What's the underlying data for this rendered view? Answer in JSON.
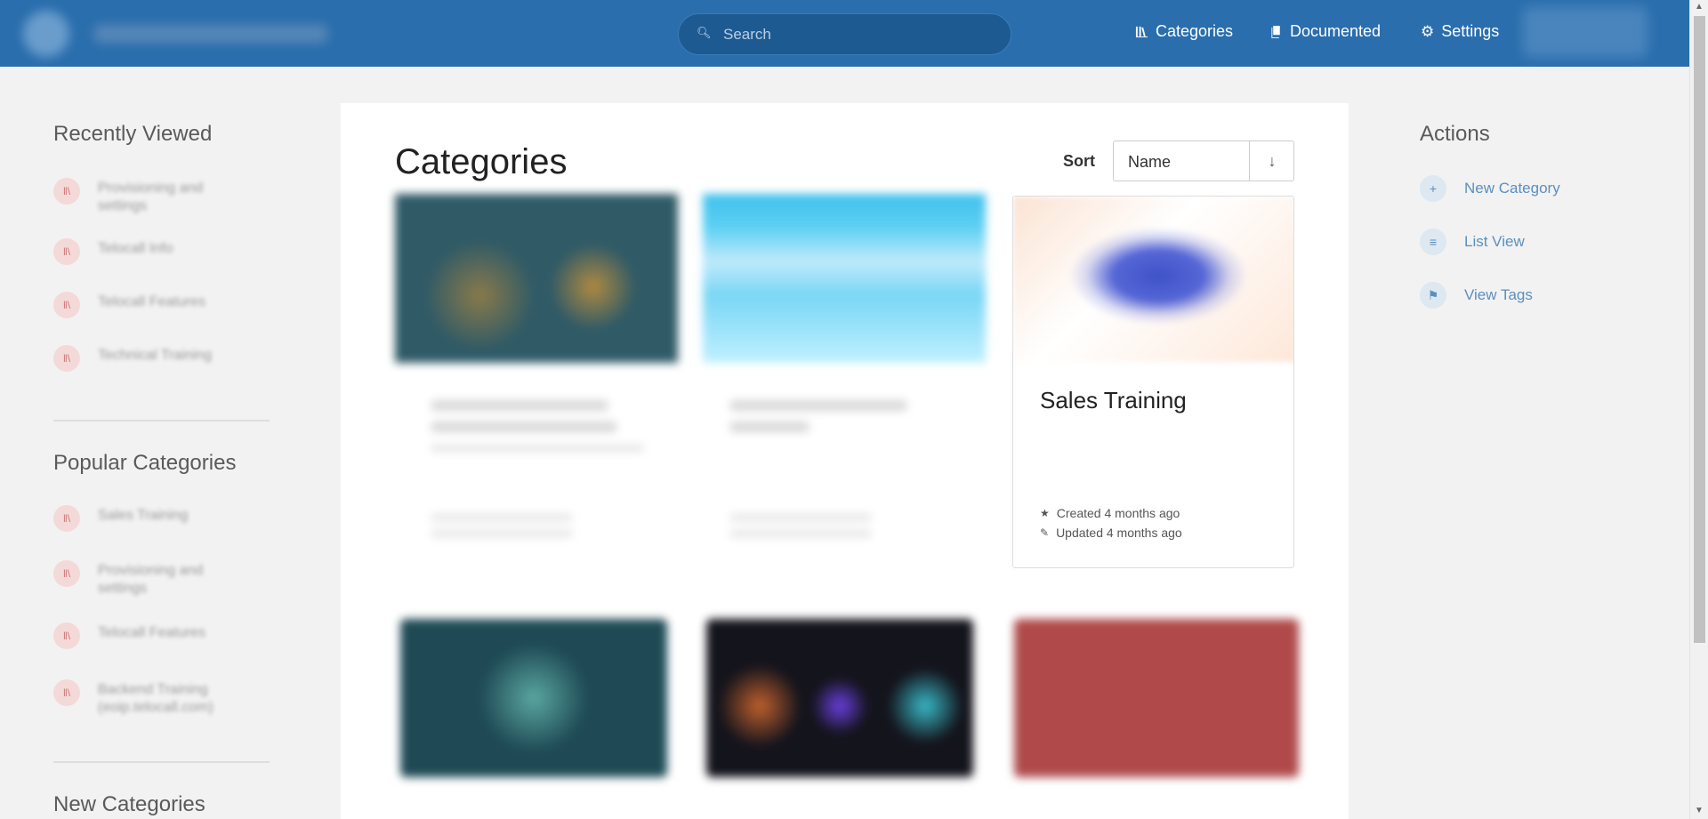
{
  "header": {
    "search_placeholder": "Search",
    "nav": [
      {
        "label": "Categories",
        "icon": "library-icon"
      },
      {
        "label": "Documented",
        "icon": "document-icon"
      },
      {
        "label": "Settings",
        "icon": "gear-icon"
      }
    ]
  },
  "left_sidebar": {
    "recently_viewed_title": "Recently Viewed",
    "recently_viewed": [
      "Provisioning and settings",
      "Telocall Info",
      "Telocall Features",
      "Technical Training"
    ],
    "popular_title": "Popular Categories",
    "popular": [
      "Sales Training",
      "Provisioning and settings",
      "Telocall Features",
      "Backend Training (eoip.telocall.com)"
    ],
    "new_title": "New Categories"
  },
  "main": {
    "title": "Categories",
    "sort_label": "Sort",
    "sort_value": "Name",
    "sort_direction": "↓",
    "featured_card": {
      "title": "Sales Training",
      "created": "Created 4 months ago",
      "updated": "Updated 4 months ago"
    }
  },
  "actions": {
    "title": "Actions",
    "items": [
      {
        "label": "New Category",
        "icon": "plus-icon"
      },
      {
        "label": "List View",
        "icon": "list-icon"
      },
      {
        "label": "View Tags",
        "icon": "tag-icon"
      }
    ]
  },
  "colors": {
    "header": "#2a6ead",
    "accent": "#5b8fbf"
  }
}
